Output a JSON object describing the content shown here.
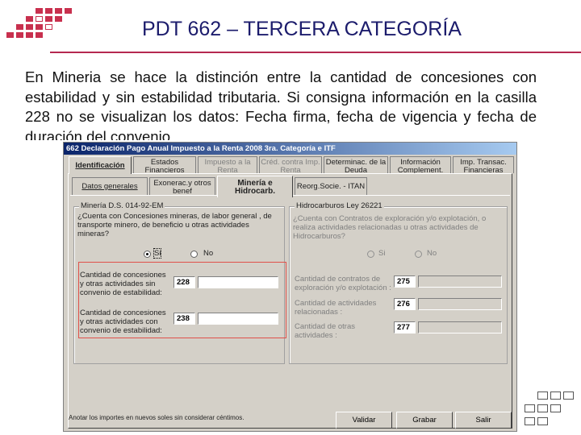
{
  "slide": {
    "title": "PDT 662 – TERCERA CATEGORÍA",
    "body": "En Mineria se hace la distinción entre la cantidad de concesiones con estabilidad y sin estabilidad tributaria. Si consigna información en la casilla 228 no se visualizan los datos: Fecha firma, fecha de vigencia y fecha de duración del convenio."
  },
  "colors": {
    "title": "#1c1c6c",
    "rule": "#b52850",
    "logo": "#c8304e",
    "highlight": "#e0504a",
    "titlebar": "#0a246a"
  },
  "window": {
    "title": "662 Declaración Pago Anual Impuesto a la Renta 2008 3ra. Categoría e ITF",
    "tabs_top": [
      {
        "label": "Identificación"
      },
      {
        "label1": "Estados",
        "label2": "Financieros"
      },
      {
        "label1": "Impuesto a la",
        "label2": "Renta"
      },
      {
        "label1": "Créd. contra Imp.",
        "label2": "Renta"
      },
      {
        "label1": "Determinac. de la",
        "label2": "Deuda"
      },
      {
        "label1": "Información",
        "label2": "Complement."
      },
      {
        "label1": "Imp. Transac.",
        "label2": "Financieras"
      }
    ],
    "tabs_sub": [
      {
        "label": "Datos generales"
      },
      {
        "label1": "Exonerac.y otros",
        "label2": "benef"
      },
      {
        "label1": "Minería e",
        "label2": "Hidrocarb."
      },
      {
        "label": "Reorg.Socie. - ITAN"
      }
    ],
    "mineria": {
      "group_title": "Minería D.S. 014-92-EM",
      "question": "¿Cuenta con Concesiones mineras, de labor general , de transporte minero, de beneficio u otras actividades mineras?",
      "yes": "Si",
      "no": "No",
      "field1_label": "Cantidad de concesiones y otras actividades sin convenio de estabilidad:",
      "field1_code": "228",
      "field2_label": "Cantidad de concesiones y otras actividades con convenio de estabilidad:",
      "field2_code": "238"
    },
    "hidrocarburos": {
      "group_title": "Hidrocarburos Ley 26221",
      "question": "¿Cuenta con Contratos de exploración y/o explotación, o realiza actividades relacionadas u otras actividades de Hidrocarburos?",
      "yes": "Si",
      "no": "No",
      "field1_label": "Cantidad de contratos de exploración y/o explotación :",
      "field1_code": "275",
      "field2_label": "Cantidad de actividades relacionadas :",
      "field2_code": "276",
      "field3_label": "Cantidad de otras actividades :",
      "field3_code": "277"
    },
    "footer_note": "Anotar los importes en nuevos soles sin considerar céntimos.",
    "buttons": {
      "validar": "Validar",
      "grabar": "Grabar",
      "salir": "Salir"
    }
  }
}
